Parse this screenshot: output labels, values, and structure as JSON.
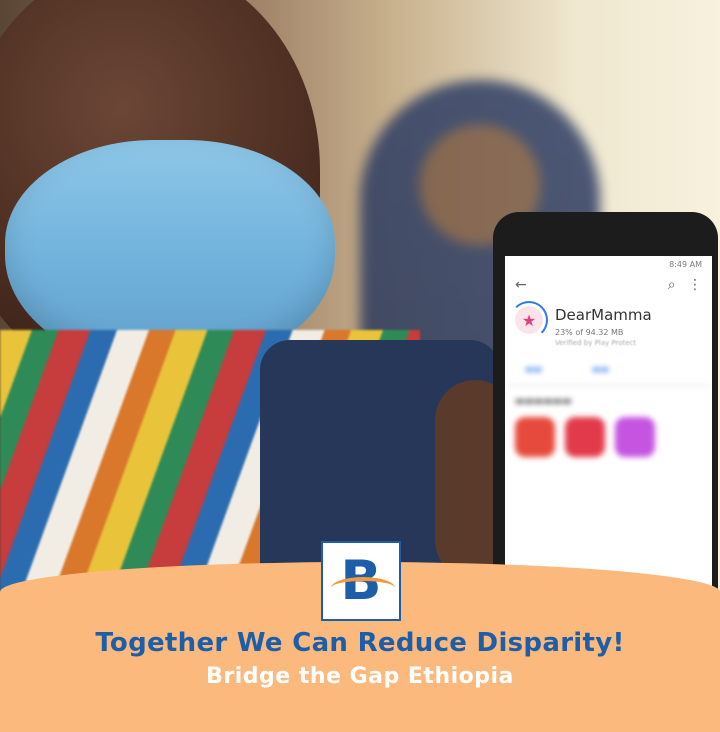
{
  "phone": {
    "app": {
      "name": "DearMamma",
      "progress": "23% of 94.32 MB",
      "verified": "Verified by Play Protect"
    },
    "status_time": "8:49 AM"
  },
  "banner": {
    "headline": "Together We Can Reduce Disparity!",
    "subline": "Bridge the Gap Ethiopia",
    "logo_letter": "B"
  },
  "colors": {
    "banner_bg": "#fcb97e",
    "brand_blue": "#1d5ea8",
    "accent_orange": "#f59a3c"
  },
  "icons": [
    "back-arrow-icon",
    "search-icon",
    "more-vert-icon",
    "app-star-icon"
  ]
}
